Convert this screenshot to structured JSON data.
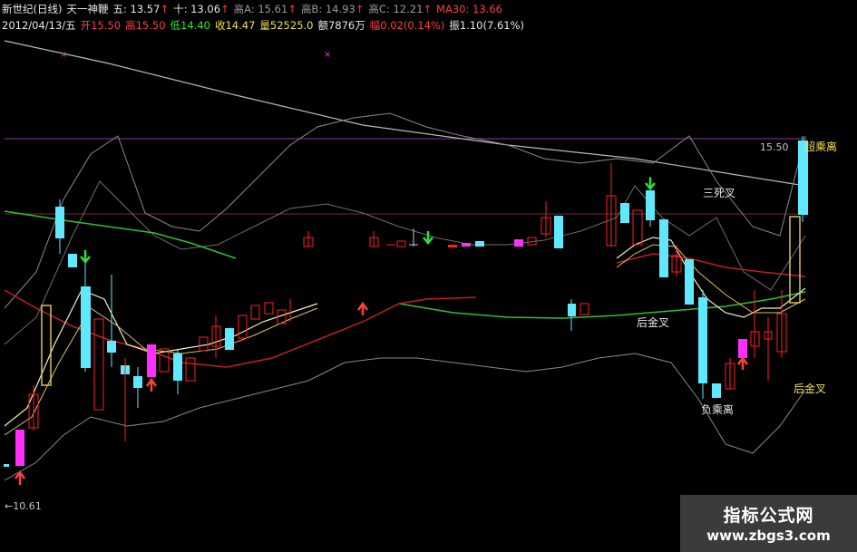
{
  "header": {
    "line1": [
      {
        "text": "新世纪(日线)",
        "cls": "w"
      },
      {
        "text": "天一神鞭",
        "cls": "w"
      },
      {
        "text": "五: 13.57",
        "cls": "w",
        "arrow": "↑"
      },
      {
        "text": "十: 13.06",
        "cls": "w",
        "arrow": "↑"
      },
      {
        "text": "高A: 15.61",
        "cls": "gr",
        "arrow": "↑"
      },
      {
        "text": "高B: 14.93",
        "cls": "gr",
        "arrow": "↑"
      },
      {
        "text": "高C: 12.21",
        "cls": "gr",
        "arrow": "↑"
      },
      {
        "text": "MA30: 13.66",
        "cls": "r"
      }
    ],
    "line2": [
      {
        "text": "2012/04/13/五",
        "cls": "w"
      },
      {
        "text": "开15.50",
        "cls": "r"
      },
      {
        "text": "高15.50",
        "cls": "r"
      },
      {
        "text": "低14.40",
        "cls": "g"
      },
      {
        "text": "收14.47",
        "cls": "y"
      },
      {
        "text": "量52525.0",
        "cls": "y"
      },
      {
        "text": "额7876万",
        "cls": "w"
      },
      {
        "text": "幅0.02(0.14%)",
        "cls": "r"
      },
      {
        "text": "振1.10(7.61%)",
        "cls": "w"
      }
    ]
  },
  "annotations": {
    "price_high": "15.50",
    "price_low": "←10.61",
    "sansicha": "三死叉",
    "houjincha1": "后金叉",
    "houjincha2": "后金叉",
    "fuchengli": "负乘离",
    "chaochengli": "超乘离"
  },
  "watermark": {
    "line1": "指标公式网",
    "line2": "www.zbgs3.com"
  },
  "colors": {
    "up": "#ff2020",
    "down": "#60e8ff",
    "special": "#ff30ff",
    "hollow": "#d8c060",
    "ma_red": "#c02020",
    "ma_green": "#30c030"
  },
  "chart_data": {
    "type": "candlestick",
    "ylim": [
      10.0,
      17.6
    ],
    "x_count": 100,
    "candles": [
      {
        "i": 2,
        "o": 11.0,
        "h": 11.2,
        "l": 10.6,
        "c": 10.75,
        "k": "down"
      },
      {
        "i": 4,
        "o": 10.9,
        "h": 11.9,
        "l": 10.8,
        "c": 11.6,
        "k": "special"
      },
      {
        "i": 6,
        "o": 11.5,
        "h": 12.3,
        "l": 11.4,
        "c": 12.0,
        "k": "up"
      },
      {
        "i": 8,
        "o": 12.0,
        "h": 12.9,
        "l": 11.9,
        "c": 12.7,
        "k": "up"
      },
      {
        "i": 9,
        "o": 12.4,
        "h": 14.1,
        "l": 12.4,
        "c": 13.9,
        "k": "hollow"
      },
      {
        "i": 11,
        "o": 15.2,
        "h": 15.4,
        "l": 14.6,
        "c": 14.8,
        "k": "down"
      },
      {
        "i": 13,
        "o": 14.4,
        "h": 14.5,
        "l": 14.1,
        "c": 14.2,
        "k": "down"
      },
      {
        "i": 15,
        "o": 13.9,
        "h": 14.0,
        "l": 12.8,
        "c": 12.9,
        "k": "down"
      },
      {
        "i": 16,
        "o": 13.4,
        "h": 13.5,
        "l": 12.2,
        "c": 12.3,
        "k": "up"
      },
      {
        "i": 18,
        "o": 13.2,
        "h": 13.7,
        "l": 12.6,
        "c": 13.0,
        "k": "down"
      },
      {
        "i": 20,
        "o": 12.9,
        "h": 13.3,
        "l": 12.8,
        "c": 12.8,
        "k": "down"
      },
      {
        "i": 22,
        "o": 12.7,
        "h": 13.0,
        "l": 12.4,
        "c": 12.6,
        "k": "down"
      },
      {
        "i": 24,
        "o": 12.7,
        "h": 13.2,
        "l": 12.5,
        "c": 13.1,
        "k": "special"
      },
      {
        "i": 26,
        "o": 12.7,
        "h": 13.1,
        "l": 12.6,
        "c": 13.0,
        "k": "up"
      },
      {
        "i": 28,
        "o": 12.9,
        "h": 13.1,
        "l": 12.6,
        "c": 12.7,
        "k": "down"
      },
      {
        "i": 30,
        "o": 12.8,
        "h": 13.2,
        "l": 12.7,
        "c": 13.1,
        "k": "up"
      },
      {
        "i": 32,
        "o": 13.1,
        "h": 13.5,
        "l": 13.0,
        "c": 13.4,
        "k": "up"
      },
      {
        "i": 34,
        "o": 13.1,
        "h": 13.5,
        "l": 13.0,
        "c": 13.3,
        "k": "up"
      },
      {
        "i": 35,
        "o": 13.2,
        "h": 13.7,
        "l": 13.1,
        "c": 13.4,
        "k": "up"
      },
      {
        "i": 37,
        "o": 13.5,
        "h": 13.3,
        "l": 13.2,
        "c": 13.2,
        "k": "down"
      },
      {
        "i": 38,
        "o": 13.5,
        "h": 13.9,
        "l": 13.4,
        "c": 13.8,
        "k": "up"
      },
      {
        "i": 40,
        "o": 13.7,
        "h": 14.0,
        "l": 13.6,
        "c": 13.9,
        "k": "up"
      },
      {
        "i": 42,
        "o": 13.8,
        "h": 14.0,
        "l": 13.7,
        "c": 13.9,
        "k": "up"
      },
      {
        "i": 44,
        "o": 13.9,
        "h": 14.0,
        "l": 13.7,
        "c": 13.8,
        "k": "up"
      },
      {
        "i": 50,
        "o": 14.4,
        "h": 14.6,
        "l": 14.4,
        "c": 14.5,
        "k": "up"
      },
      {
        "i": 62,
        "o": 14.4,
        "h": 14.5,
        "l": 14.4,
        "c": 14.5,
        "k": "up"
      },
      {
        "i": 65,
        "o": 14.4,
        "h": 14.5,
        "l": 14.4,
        "c": 14.45,
        "k": "up"
      },
      {
        "i": 67,
        "o": 14.45,
        "h": 14.8,
        "l": 14.4,
        "c": 14.4,
        "k": "up"
      },
      {
        "i": 69,
        "o": 14.4,
        "h": 14.6,
        "l": 14.3,
        "c": 14.45,
        "k": "down"
      },
      {
        "i": 72,
        "o": 14.4,
        "h": 14.5,
        "l": 14.35,
        "c": 14.45,
        "k": "special"
      },
      {
        "i": 74,
        "o": 14.4,
        "h": 14.5,
        "l": 14.35,
        "c": 14.45,
        "k": "down"
      },
      {
        "i": 77,
        "o": 14.4,
        "h": 14.5,
        "l": 14.35,
        "c": 14.5,
        "k": "special"
      },
      {
        "i": 80,
        "o": 14.4,
        "h": 14.6,
        "l": 14.35,
        "c": 14.6,
        "k": "down"
      },
      {
        "i": 82,
        "o": 14.5,
        "h": 15.1,
        "l": 14.4,
        "c": 14.9,
        "k": "up"
      },
      {
        "i": 84,
        "o": 14.4,
        "h": 15.0,
        "l": 14.4,
        "c": 14.8,
        "k": "down"
      },
      {
        "i": 89,
        "o": 14.3,
        "h": 14.5,
        "l": 13.8,
        "c": 13.9,
        "k": "down"
      },
      {
        "i": 94,
        "o": 14.5,
        "h": 15.2,
        "l": 14.4,
        "c": 15.1,
        "k": "up"
      },
      {
        "i": 96,
        "o": 14.9,
        "h": 15.4,
        "l": 14.8,
        "c": 14.9,
        "k": "down"
      }
    ]
  }
}
